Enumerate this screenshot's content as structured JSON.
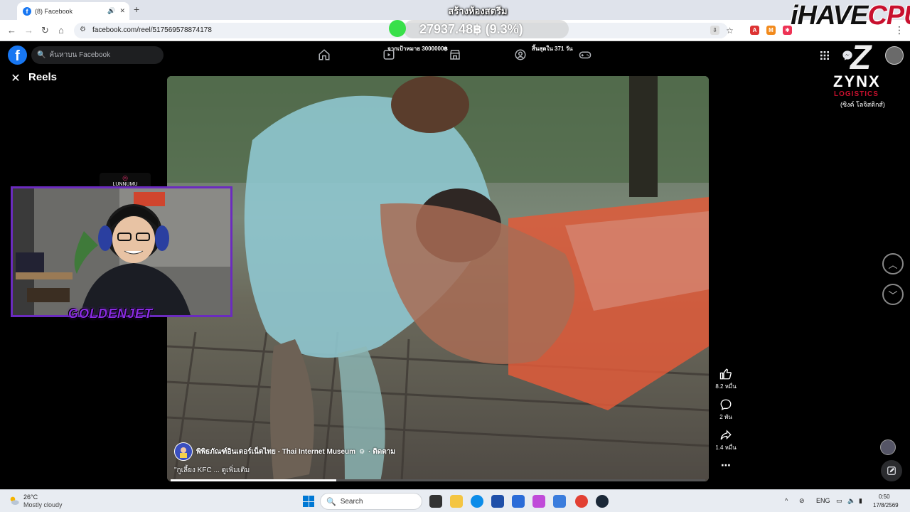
{
  "browser": {
    "tab_title": "(8) Facebook",
    "url": "facebook.com/reel/517569578874178",
    "stream_title": "สร้างห้องสตรีม"
  },
  "overlay": {
    "price": "27937.48฿ (9.3%)",
    "goal_text": "จากเป้าหมาย 3000000฿",
    "days_left": "สิ้นสุดใน 371 วัน",
    "brand_logo": {
      "part1": "iHAVE",
      "part2": "CPU"
    }
  },
  "facebook": {
    "search_placeholder": "ค้นหาบน Facebook"
  },
  "reels": {
    "title": "Reels",
    "poster_name": "พิพิธภัณฑ์อินเตอร์เน็ตไทย - Thai Internet Museum",
    "follow_label": "· ติดตาม",
    "caption": "\"กูเลี้ยง KFC ... ดูเพิ่มเติม",
    "likes": "8.2 หมื่น",
    "comments": "2 พัน",
    "shares": "1.4 หมื่น",
    "progress": 0.31
  },
  "webcam": {
    "streamer_name": "GOLDENJET",
    "top_label": "LUNNUMU"
  },
  "sponsor": {
    "letter": "Z",
    "name": "ZYNX",
    "sub": "LOGISTICS",
    "thai": "(ซิงค์ โลจิสติกส์)"
  },
  "taskbar": {
    "temp": "26°C",
    "weather": "Mostly cloudy",
    "search_label": "Search",
    "lang": "ENG",
    "time": "0:50",
    "date": "17/8/2569"
  },
  "colors": {
    "fb_blue": "#1877f2",
    "accent_purple": "#6b2bbf",
    "price_green": "#39e04a",
    "brand_red": "#c8102e"
  }
}
